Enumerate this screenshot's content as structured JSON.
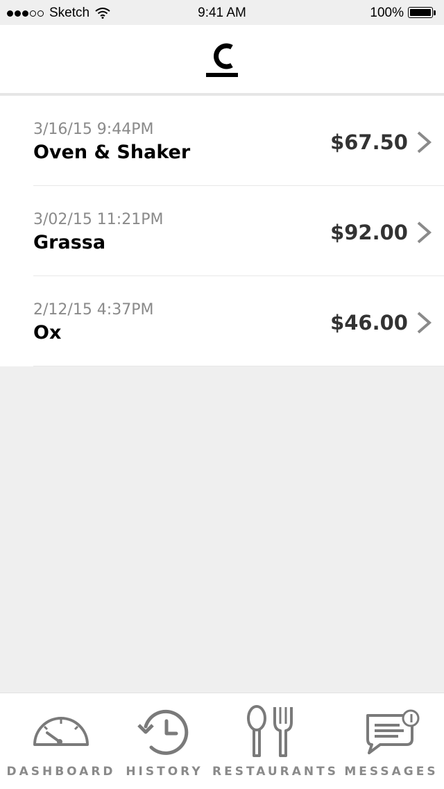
{
  "status_bar": {
    "carrier": "Sketch",
    "signal_full": 3,
    "signal_total": 5,
    "time": "9:41 AM",
    "battery": "100%"
  },
  "nav": {
    "logo_icon": "c-logo-icon"
  },
  "transactions": [
    {
      "datetime": "3/16/15 9:44PM",
      "name": "Oven & Shaker",
      "amount": "$67.50"
    },
    {
      "datetime": "3/02/15 11:21PM",
      "name": "Grassa",
      "amount": "$92.00"
    },
    {
      "datetime": "2/12/15 4:37PM",
      "name": "Ox",
      "amount": "$46.00"
    }
  ],
  "tabs": [
    {
      "label": "DASHBOARD",
      "icon": "dashboard-gauge-icon"
    },
    {
      "label": "HISTORY",
      "icon": "history-clock-icon"
    },
    {
      "label": "RESTAURANTS",
      "icon": "spoon-fork-icon"
    },
    {
      "label": "MESSAGES",
      "icon": "message-bubble-icon"
    }
  ],
  "colors": {
    "background": "#efefef",
    "text_primary": "#000000",
    "text_secondary": "#8a8a8a",
    "icon_gray": "#7a7a7a"
  }
}
